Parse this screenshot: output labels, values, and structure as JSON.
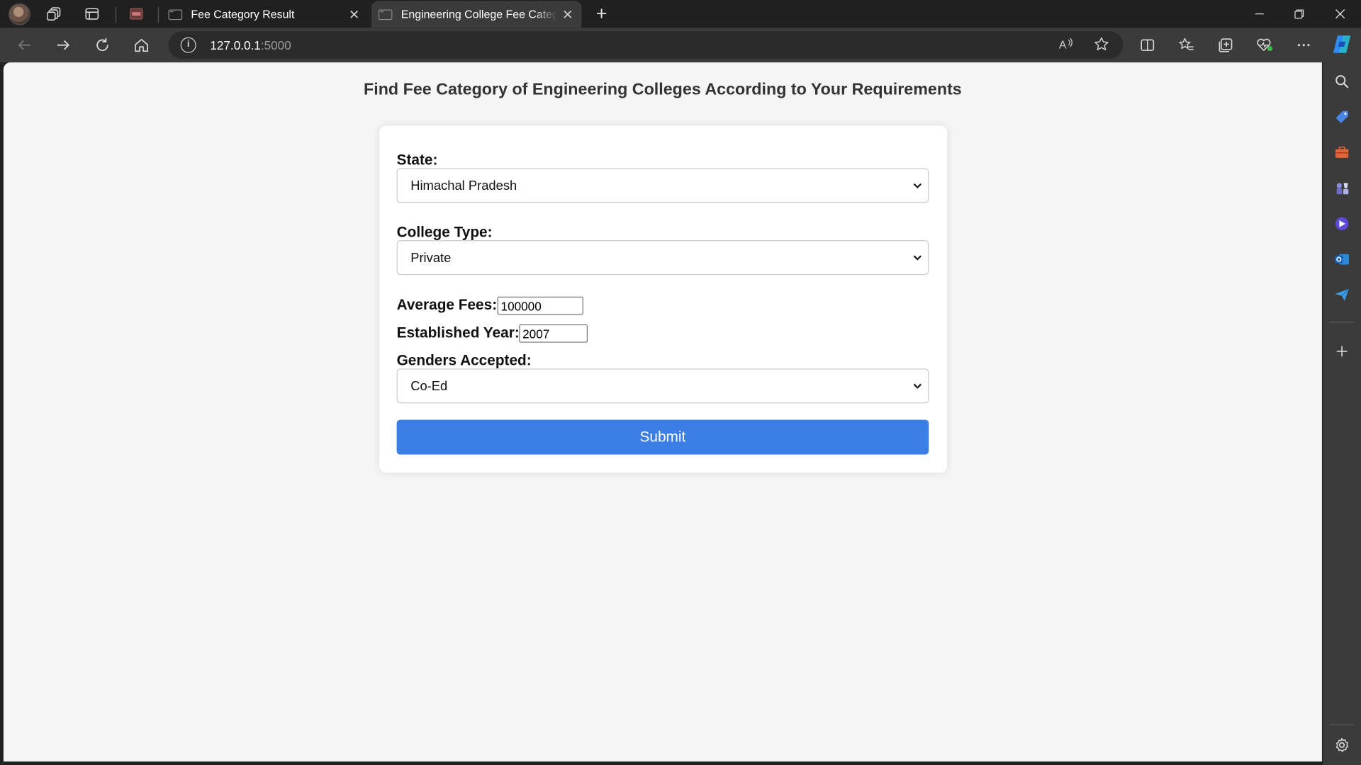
{
  "browser": {
    "tabs": [
      {
        "title": "Fee Category Result",
        "active": false
      },
      {
        "title": "Engineering College Fee Category",
        "active": true
      }
    ],
    "address": {
      "host": "127.0.0.1",
      "port": ":5000"
    }
  },
  "page": {
    "heading": "Find Fee Category of Engineering Colleges According to Your Requirements",
    "form": {
      "state": {
        "label": "State:",
        "value": "Himachal Pradesh"
      },
      "college_type": {
        "label": "College Type:",
        "value": "Private"
      },
      "average_fees": {
        "label": "Average Fees:",
        "value": "100000"
      },
      "established_year": {
        "label": "Established Year:",
        "value": "2007"
      },
      "genders_accepted": {
        "label": "Genders Accepted:",
        "value": "Co-Ed"
      },
      "submit_label": "Submit"
    },
    "colors": {
      "submit": "#3a7ee6",
      "background": "#f5f5f5",
      "card": "#ffffff"
    }
  }
}
